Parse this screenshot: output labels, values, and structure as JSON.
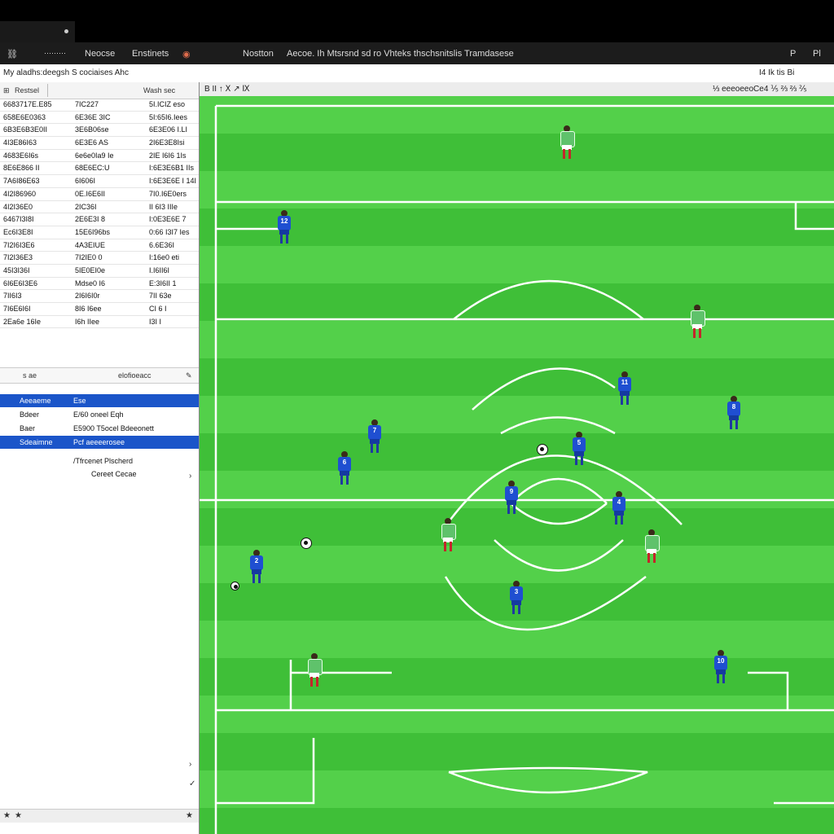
{
  "menubar": {
    "items": [
      "Neocse",
      "Enstinets"
    ],
    "title": "Nostton",
    "subtitle": "Aecoe. Ih Mtsrsnd sd ro Vhteks thschsnitslis Tramdasese",
    "right": [
      "P",
      "Pl"
    ]
  },
  "toolbar": {
    "text": "My aladhs:deegsh S cociaises Ahc",
    "right": "I4 Ik tis Bi"
  },
  "left_panel": {
    "headers": [
      "Restsel",
      "Wash sec"
    ],
    "rows": [
      [
        "6683717E.E85",
        "7IC227",
        "5I.ICIZ eso"
      ],
      [
        "658E6E0363",
        "6E36E 3IC",
        "5I:65I6.Iees"
      ],
      [
        "6B3E6B3E0II",
        "3E6B06se",
        "6E3E06 I.LI"
      ],
      [
        "4I3E86I63",
        "6E3E6 AS",
        "2I6E3E8Isi"
      ],
      [
        "4683E6I6s",
        "6e6e0Ia9 Ie",
        "2IE I6I6 1Is"
      ],
      [
        "8E6E866 II",
        "68E6EC:U",
        "I:6E3E6B1 IIs"
      ],
      [
        "7A6I86E63",
        "6I606I",
        "I:6E3E6E I 14I"
      ],
      [
        "4I2I86960",
        "0E.I6E6II",
        "7I0.I6E0ers"
      ],
      [
        "4I2I36E0",
        "2IC36I",
        "II 6I3 IIIe"
      ],
      [
        "6467I3I8I",
        "2E6E3I 8",
        "I:0E3E6E 7"
      ],
      [
        "Ec6I3E8I",
        "15E6I96bs",
        "0:66 I3I7 Ies"
      ],
      [
        "7I2I6I3E6",
        "4A3EIUE",
        "6.6E36I"
      ],
      [
        "7I2I36E3",
        "7I2IE0 0",
        "I:16e0 eti"
      ],
      [
        "45I3I36I",
        "5IE0EI0e",
        "I.I6II6I"
      ],
      [
        "6I6E6I3E6",
        "Mdse0 I6",
        "E:3I6II 1"
      ],
      [
        "7II6I3",
        "2I6I6I0r",
        "7II 63e"
      ],
      [
        "7I6E6I6I",
        "8I6 I6ee",
        "CI 6 I"
      ],
      [
        "2Ea6e 16Ie",
        "I6h IIee",
        "I3I I"
      ]
    ],
    "prop_header": [
      "s ae",
      "elofioeacc",
      "ie"
    ],
    "props": [
      {
        "key": "Aeeaeme",
        "val": "Ese",
        "selected": true
      },
      {
        "key": "Bdeer",
        "val": "E/60 oneel Eqh",
        "selected": false
      },
      {
        "key": "Baer",
        "val": "E5900 T5ocel Bdeeonett",
        "selected": false
      },
      {
        "key": "Sdeaimne",
        "val": "Pcf aeeeerosee",
        "selected": true
      }
    ],
    "note1": "/Tfrcenet Plscherd",
    "note2": "Cereet Cecae"
  },
  "pitch_toolbar": {
    "left": "B II ↑ Ⅹ ↗ Ⅸ",
    "right": "⅓ eeeoeeoCe4 ⅕ ⅔ ⅔ ⅖"
  },
  "colors": {
    "pitch_light": "#53d04a",
    "pitch_dark": "#3fbf38",
    "team_blue": "#1f4fd1",
    "team_green": "#5fc26b",
    "selection": "#1b55c9"
  },
  "players": [
    {
      "team": "blue",
      "number": "10"
    },
    {
      "team": "blue",
      "number": "11"
    },
    {
      "team": "blue",
      "number": "8"
    },
    {
      "team": "blue",
      "number": "5"
    },
    {
      "team": "blue",
      "number": "7"
    },
    {
      "team": "blue",
      "number": "6"
    },
    {
      "team": "blue",
      "number": "9"
    },
    {
      "team": "blue",
      "number": "4"
    },
    {
      "team": "blue",
      "number": "3"
    },
    {
      "team": "blue",
      "number": "2"
    },
    {
      "team": "blue",
      "number": "12"
    },
    {
      "team": "green",
      "number": ""
    },
    {
      "team": "green",
      "number": ""
    },
    {
      "team": "green",
      "number": ""
    },
    {
      "team": "green",
      "number": ""
    },
    {
      "team": "green",
      "number": ""
    }
  ]
}
